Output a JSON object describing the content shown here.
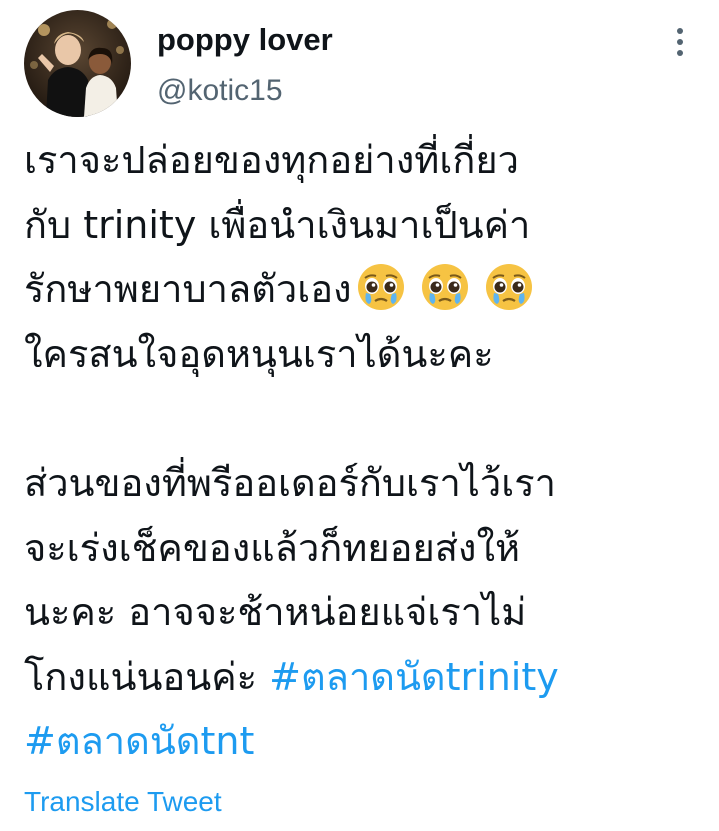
{
  "author": {
    "display_name": "poppy lover",
    "handle": "@kotic15"
  },
  "icons": {
    "more": "more-vertical-icon",
    "emoji": "pleading-crying-face-emoji"
  },
  "tweet": {
    "lines": [
      "เราจะปล่อยของทุกอย่างที่เกี่ยว",
      "กับ trinity เพื่อนำเงินมาเป็นค่า",
      "รักษาพยาบาลตัวเอง",
      "ใครสนใจอุดหนุนเราได้นะคะ",
      "ส่วนของที่พรีออเดอร์กับเราไว้เรา",
      "จะเร่งเช็คของแล้วก็ทยอยส่งให้",
      "นะคะ อาจจะช้าหน่อยแจ่เราไม่",
      "โกงแน่นอนค่ะ "
    ],
    "hashtags": [
      "#ตลาดนัดtrinity",
      "#ตลาดนัดtnt"
    ]
  },
  "translate_label": "Translate Tweet",
  "colors": {
    "text": "#0f1419",
    "secondary": "#536471",
    "link": "#1d9bf0",
    "background": "#ffffff"
  }
}
